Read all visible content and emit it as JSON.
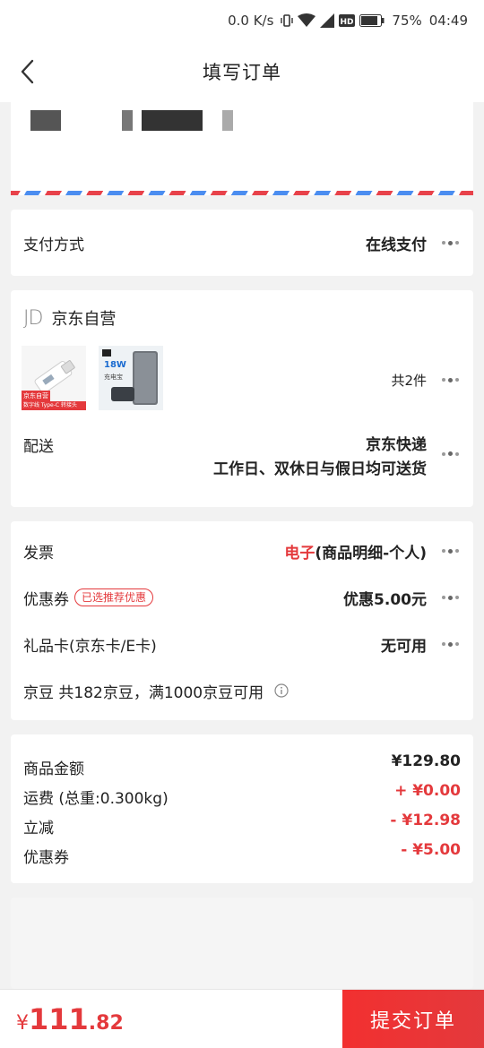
{
  "status_bar": {
    "network_speed": "0.0 K/s",
    "battery": "75%",
    "time": "04:49",
    "icons": [
      "vibrate-icon",
      "wifi-icon",
      "signal-icon",
      "hd-icon",
      "battery-icon"
    ]
  },
  "header": {
    "title": "填写订单"
  },
  "payment": {
    "label": "支付方式",
    "value": "在线支付"
  },
  "shop": {
    "logo": "JD",
    "name": "京东自营",
    "item_count": "共2件",
    "delivery_label": "配送",
    "delivery_line1": "京东快递",
    "delivery_line2": "工作日、双休日与假日均可送货",
    "products": [
      {
        "badge": "京东自营",
        "caption": "数字线 Type-C 转接头"
      },
      {
        "title": "18W",
        "caption": "充电宝"
      }
    ]
  },
  "options": {
    "invoice": {
      "label": "发票",
      "value_highlight": "电子",
      "value_rest": "(商品明细-个人)"
    },
    "coupon": {
      "label": "优惠券",
      "badge": "已选推荐优惠",
      "value": "优惠5.00元"
    },
    "gift_card": {
      "label": "礼品卡(京东卡/E卡)",
      "value": "无可用"
    },
    "jingdou": {
      "label": "京豆 共182京豆，满1000京豆可用",
      "icon": "info-icon"
    }
  },
  "summary": {
    "goods": {
      "label": "商品金额",
      "value": "¥129.80"
    },
    "shipping": {
      "label": "运费 (总重:0.300kg)",
      "value": "+ ¥0.00"
    },
    "discount": {
      "label": "立减",
      "value": "- ¥12.98"
    },
    "coupon": {
      "label": "优惠券",
      "value": "- ¥5.00"
    }
  },
  "bottom": {
    "currency": "¥",
    "total_int": "111",
    "total_dec": ".82",
    "submit_label": "提交订单"
  },
  "colors": {
    "accent": "#e4393c",
    "background": "#f2f2f2"
  }
}
